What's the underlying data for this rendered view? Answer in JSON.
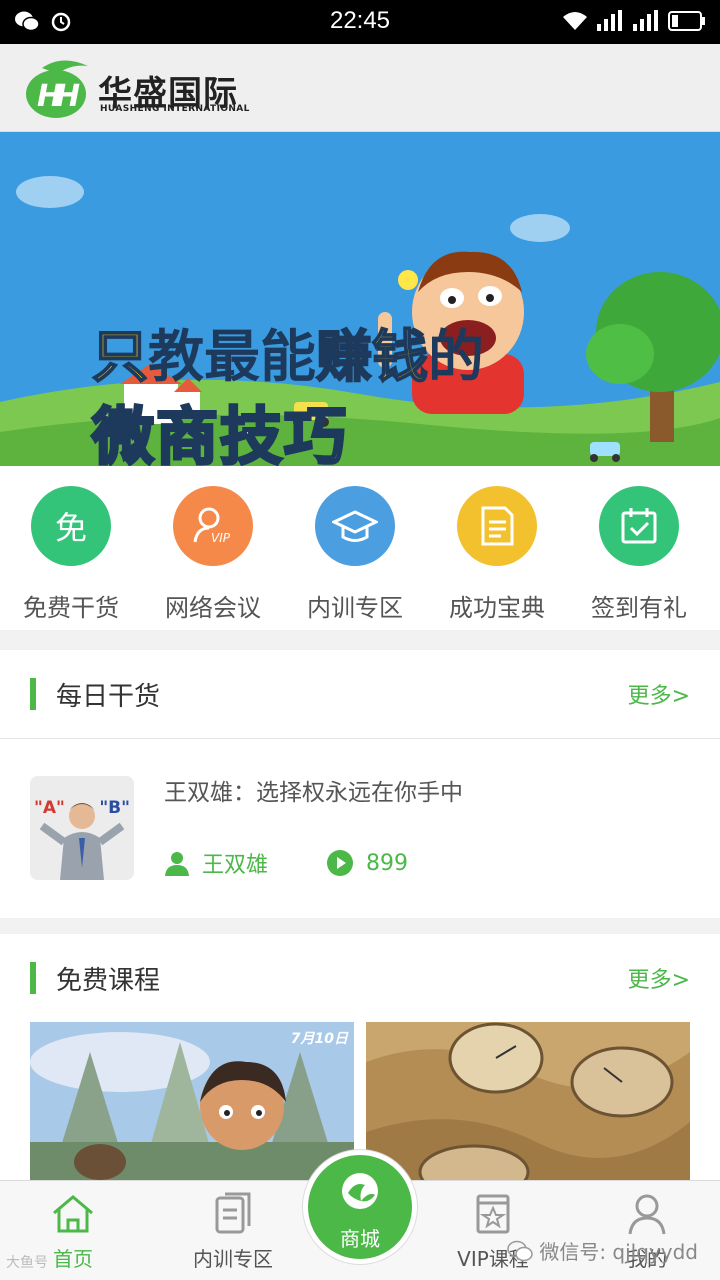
{
  "status_bar": {
    "time": "22:45"
  },
  "header": {
    "logo_cn": "华盛国际",
    "logo_en": "HUASHENG INTERNATIONAL"
  },
  "banner": {
    "line1_a": "只",
    "line1_b": "教最能",
    "line1_c": "赚钱",
    "line1_d": "的",
    "line2": "微商技巧"
  },
  "quick_menu": [
    {
      "label": "免费干货",
      "glyph": "免",
      "icon": "free-icon",
      "color": "#33c47a"
    },
    {
      "label": "网络会议",
      "glyph": "VIP",
      "icon": "vip-user-icon",
      "color": "#f5894a"
    },
    {
      "label": "内训专区",
      "glyph": "",
      "icon": "graduation-cap-icon",
      "color": "#4b9ee0"
    },
    {
      "label": "成功宝典",
      "glyph": "",
      "icon": "document-icon",
      "color": "#f3c12d"
    },
    {
      "label": "签到有礼",
      "glyph": "",
      "icon": "calendar-check-icon",
      "color": "#33c47a"
    }
  ],
  "daily": {
    "title": "每日干货",
    "more": "更多>",
    "article": {
      "title": "王双雄：选择权永远在你手中",
      "author": "王双雄",
      "plays": "899",
      "thumb_left": "\"A\"",
      "thumb_right": "\"B\""
    }
  },
  "courses": {
    "title": "免费课程",
    "more": "更多>",
    "date_badge": "7月10日"
  },
  "tabbar": {
    "home": "首页",
    "training": "内训专区",
    "mall": "商城",
    "vip": "VIP课程",
    "mine": "我的"
  },
  "watermark": {
    "left": "大鱼号",
    "right": "微信号: qjlqyydd"
  },
  "colors": {
    "brand_green": "#4cb848",
    "banner_sky": "#3a9be0"
  }
}
